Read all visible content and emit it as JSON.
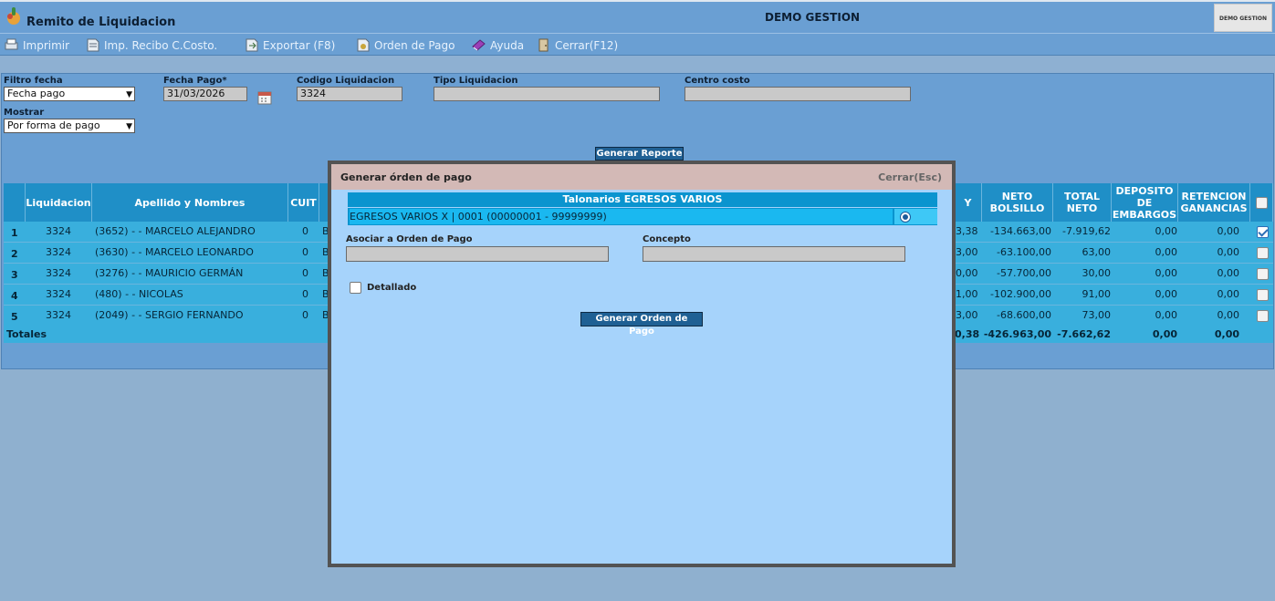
{
  "app": {
    "title": "Remito de Liquidacion",
    "company": "DEMO GESTION",
    "brand": "DEMO GESTION"
  },
  "toolbar": [
    {
      "label": "Imprimir",
      "icon": "printer-icon"
    },
    {
      "label": "Imp. Recibo C.Costo.",
      "icon": "receipt-icon"
    },
    {
      "label": "Exportar (F8)",
      "icon": "export-icon"
    },
    {
      "label": "Orden de Pago",
      "icon": "payment-order-icon"
    },
    {
      "label": "Ayuda",
      "icon": "help-book-icon"
    },
    {
      "label": "Cerrar(F12)",
      "icon": "close-door-icon"
    }
  ],
  "filters": {
    "filtro_fecha": {
      "label": "Filtro fecha",
      "value": "Fecha pago"
    },
    "fecha_pago": {
      "label": "Fecha Pago*",
      "value": "31/03/2026"
    },
    "codigo": {
      "label": "Codigo Liquidacion",
      "value": "3324"
    },
    "tipo": {
      "label": "Tipo Liquidacion",
      "value": ""
    },
    "centro": {
      "label": "Centro costo",
      "value": ""
    },
    "mostrar": {
      "label": "Mostrar",
      "value": "Por forma de pago"
    },
    "generate_button": "Generar Reporte"
  },
  "grid": {
    "headers": {
      "liq": "Liquidacion",
      "nombre": "Apellido y Nombres",
      "cuit": "CUIT",
      "y": "Y",
      "neto_bolsillo": "NETO BOLSILLO",
      "total_neto": "TOTAL NETO",
      "deposito": "DEPOSITO DE EMBARGOS",
      "retencion": "RETENCION GANANCIAS"
    },
    "rows": [
      {
        "n": "1",
        "liq": "3324",
        "nombre": "(3652) - - MARCELO ALEJANDRO",
        "cuit": "0",
        "b": "B",
        "y": "3,38",
        "neto_bolsillo": "-134.663,00",
        "total_neto": "-7.919,62",
        "deposito": "0,00",
        "retencion": "0,00",
        "checked": true
      },
      {
        "n": "2",
        "liq": "3324",
        "nombre": "(3630) - - MARCELO LEONARDO",
        "cuit": "0",
        "b": "B",
        "y": "3,00",
        "neto_bolsillo": "-63.100,00",
        "total_neto": "63,00",
        "deposito": "0,00",
        "retencion": "0,00",
        "checked": false
      },
      {
        "n": "3",
        "liq": "3324",
        "nombre": "(3276) - - MAURICIO GERMÁN",
        "cuit": "0",
        "b": "B",
        "y": "0,00",
        "neto_bolsillo": "-57.700,00",
        "total_neto": "30,00",
        "deposito": "0,00",
        "retencion": "0,00",
        "checked": false
      },
      {
        "n": "4",
        "liq": "3324",
        "nombre": "(480) - - NICOLAS",
        "cuit": "0",
        "b": "B",
        "y": "1,00",
        "neto_bolsillo": "-102.900,00",
        "total_neto": "91,00",
        "deposito": "0,00",
        "retencion": "0,00",
        "checked": false
      },
      {
        "n": "5",
        "liq": "3324",
        "nombre": "(2049) - - SERGIO FERNANDO",
        "cuit": "0",
        "b": "B",
        "y": "3,00",
        "neto_bolsillo": "-68.600,00",
        "total_neto": "73,00",
        "deposito": "0,00",
        "retencion": "0,00",
        "checked": false
      }
    ],
    "totals": {
      "label": "Totales",
      "y": "0,38",
      "neto_bolsillo": "-426.963,00",
      "total_neto": "-7.662,62",
      "deposito": "0,00",
      "retencion": "0,00"
    }
  },
  "modal": {
    "title": "Generar órden de pago",
    "close": "Cerrar(Esc)",
    "talonarios_header": "Talonarios EGRESOS VARIOS",
    "talonario_option": "EGRESOS VARIOS X | 0001 (00000001 - 99999999)",
    "asociar_label": "Asociar a Orden de Pago",
    "asociar_value": "",
    "concepto_label": "Concepto",
    "concepto_value": "",
    "detallado_label": "Detallado",
    "detallado_checked": false,
    "submit": "Generar Orden de Pago"
  }
}
